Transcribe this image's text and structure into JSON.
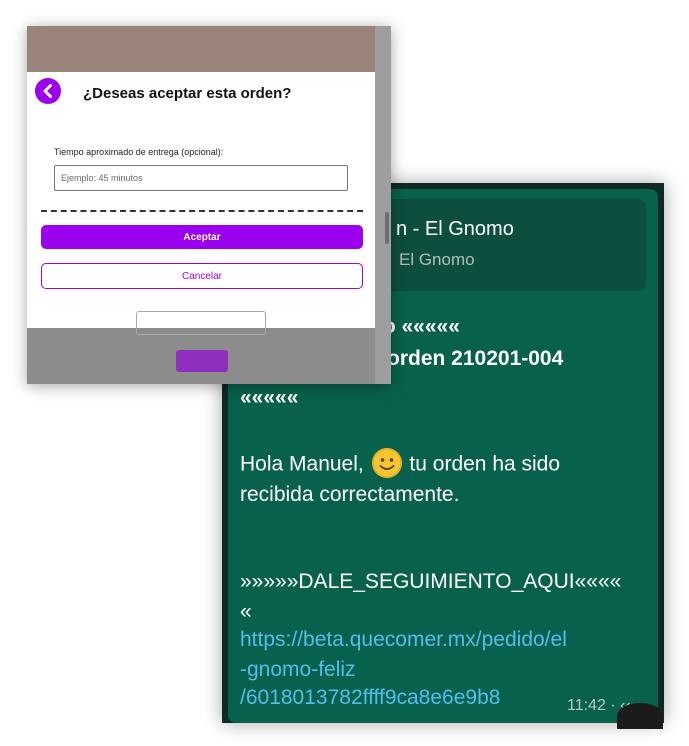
{
  "chat": {
    "quote_title": "n - El Gnomo",
    "quote_subtitle": "El Gnomo",
    "line1": "no «««««",
    "line2": "orden 210201-004",
    "line3": "«««««",
    "greeting_before": "Hola Manuel,",
    "greeting_after": "tu orden ha sido",
    "greeting_line2": "recibida correctamente.",
    "follow_line": "»»»»»DALE_SEGUIMIENTO_AQUI««««",
    "follow_line2": "«",
    "link_line1": "https://beta.quecomer.mx/pedido/el",
    "link_line2": "-gnomo-feliz",
    "link_line3": "/6018013782ffff9ca8e6e9b8",
    "time": "11:42 · ‹‹",
    "emoji": "smiling-face-icon",
    "colors": {
      "bubble": "#08614c",
      "link": "#53bdeb"
    }
  },
  "modal": {
    "title": "¿Deseas aceptar esta orden?",
    "field_label": "Tiempo aproximado de entrega (opcional):",
    "field_placeholder": "Ejemplo: 45 minutos",
    "field_value": "",
    "accept_label": "Aceptar",
    "cancel_label": "Cancelar",
    "back_icon": "chevron-left-icon",
    "colors": {
      "accent": "#9b00ef"
    }
  }
}
